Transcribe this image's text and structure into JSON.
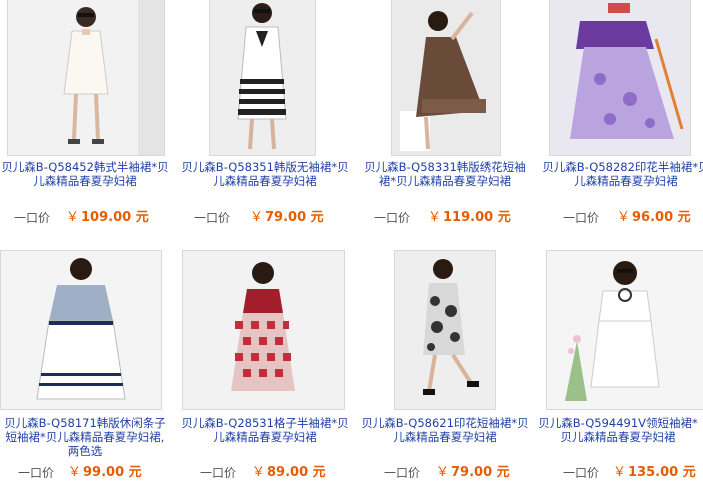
{
  "price_label": "一口价",
  "currency_symbol": "￥",
  "colors": {
    "link": "#1f3fa6",
    "price": "#e65c00",
    "label": "#555555"
  },
  "products": [
    {
      "title": "贝儿森B-Q58452韩式半袖裙*贝儿森精品春夏孕妇裙",
      "price": "109.00 元",
      "image": "white-dress-photo"
    },
    {
      "title": "贝儿森B-Q58351韩版无袖裙*贝儿森精品春夏孕妇裙",
      "price": "79.00 元",
      "image": "striped-dress-photo"
    },
    {
      "title": "贝儿森B-Q58331韩版绣花短袖裙*贝儿森精品春夏孕妇裙",
      "price": "119.00 元",
      "image": "brown-dress-photo"
    },
    {
      "title": "贝儿森B-Q58282印花半袖裙*贝儿森精品春夏孕妇裙",
      "price": "96.00 元",
      "image": "purple-floral-dress-photo"
    },
    {
      "title": "贝儿森B-Q58171韩版休闲条子短袖裙*贝儿森精品春夏孕妇裙,两色选",
      "price": "99.00 元",
      "image": "white-blue-stripe-dress-photo"
    },
    {
      "title": "贝儿森B-Q28531格子半袖裙*贝儿森精品春夏孕妇裙",
      "price": "89.00 元",
      "image": "red-check-dress-photo"
    },
    {
      "title": "贝儿森B-Q58621印花短袖裙*贝儿森精品春夏孕妇裙",
      "price": "79.00 元",
      "image": "black-print-dress-photo"
    },
    {
      "title": "贝儿森B-Q594491V领短袖裙*贝儿森精品春夏孕妇裙",
      "price": "135.00 元",
      "image": "white-vneck-dress-photo"
    }
  ]
}
